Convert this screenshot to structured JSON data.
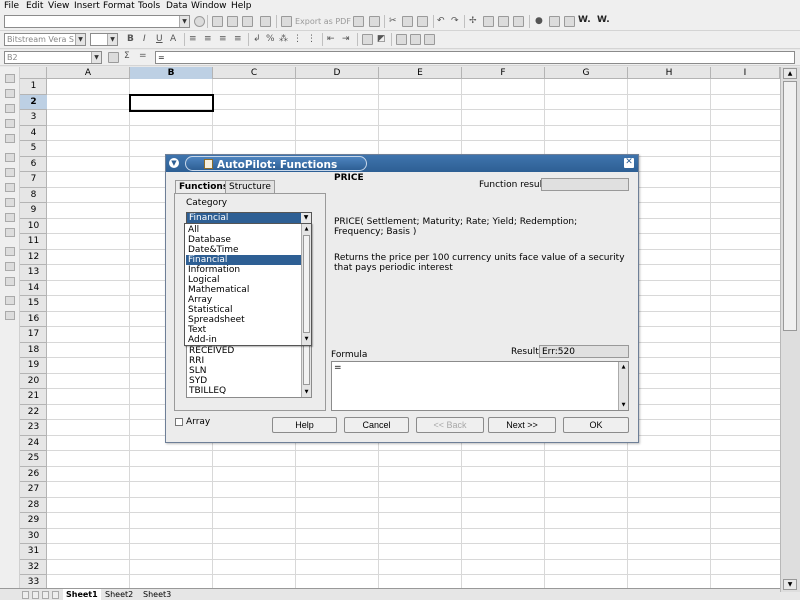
{
  "menu": [
    "File",
    "Edit",
    "View",
    "Insert",
    "Format",
    "Tools",
    "Data",
    "Window",
    "Help"
  ],
  "menu_mnemonic": [
    "F",
    "E",
    "V",
    "I",
    "o",
    "T",
    "D",
    "W",
    "H"
  ],
  "toolbar": {
    "export_pdf_label": "Export as PDF",
    "font_name": "Bitstream Vera S",
    "name_box": "B2",
    "formula_input": "="
  },
  "sheet": {
    "columns": [
      "A",
      "B",
      "C",
      "D",
      "E",
      "F",
      "G",
      "H",
      "I"
    ],
    "selected_column": "B",
    "rows": [
      "1",
      "2",
      "3",
      "4",
      "5",
      "6",
      "7",
      "8",
      "9",
      "10",
      "11",
      "12",
      "13",
      "14",
      "15",
      "16",
      "17",
      "18",
      "19",
      "20",
      "21",
      "22",
      "23",
      "24",
      "25",
      "26",
      "27",
      "28",
      "29",
      "30",
      "31",
      "32",
      "33"
    ],
    "selected_row": "2",
    "tabs": [
      "Sheet1",
      "Sheet2",
      "Sheet3"
    ],
    "active_tab": "Sheet1"
  },
  "dialog": {
    "title": "AutoPilot: Functions",
    "tabs": [
      "Functions",
      "Structure"
    ],
    "category_label": "Category",
    "category_selected": "Financial",
    "category_options": [
      "All",
      "Database",
      "Date&Time",
      "Financial",
      "Information",
      "Logical",
      "Mathematical",
      "Array",
      "Statistical",
      "Spreadsheet",
      "Text",
      "Add-in"
    ],
    "function_items_visible": [
      "RECEIVED",
      "RRI",
      "SLN",
      "SYD",
      "TBILLEQ"
    ],
    "function_result_label": "Function result",
    "function_name": "PRICE",
    "function_signature": "PRICE( Settlement; Maturity; Rate; Yield; Redemption; Frequency; Basis  )",
    "function_description": "Returns the price per 100 currency units face value of a security that pays periodic interest",
    "formula_label": "Formula",
    "result_label": "Result",
    "result_value": "Err:520",
    "formula_text": "=",
    "array_label": "Array",
    "buttons": {
      "help": "Help",
      "cancel": "Cancel",
      "back": "<< Back",
      "next": "Next >>",
      "ok": "OK"
    }
  }
}
